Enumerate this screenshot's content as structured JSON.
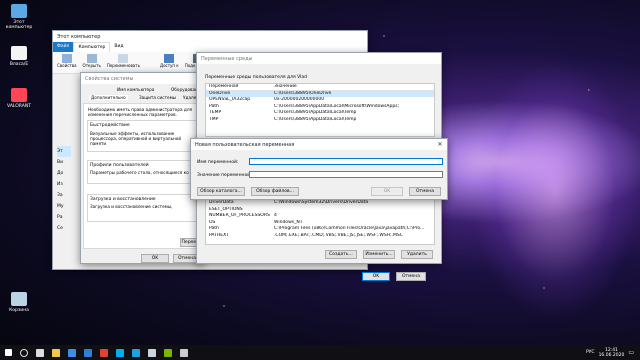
{
  "desktop": {
    "icons": [
      {
        "label": "Этот компьютер",
        "icon": "computer-icon"
      },
      {
        "label": "Власа/Е",
        "icon": "folder-icon"
      },
      {
        "label": "VALORANT",
        "icon": "valorant-icon"
      },
      {
        "label": "Корзина",
        "icon": "recycle-bin-icon"
      }
    ]
  },
  "explorer": {
    "title": "Этот компьютер",
    "tabs": [
      "Файл",
      "Компьютер",
      "Вид"
    ],
    "ribbon": [
      "Свойства",
      "Открыть",
      "Переименовать",
      "Доступ к",
      "Подключить"
    ],
    "sidebar": [
      "Эт",
      "Ви",
      "До",
      "Из",
      "За",
      "Му",
      "Ра",
      "Се"
    ]
  },
  "sysprops": {
    "title": "Свойства системы",
    "tabs": [
      "Имя компьютера",
      "Оборудование",
      "Дополнительно",
      "Защита системы",
      "Удаленный"
    ],
    "admin_note": "Необходимо иметь права администратора для изменения перечисленных параметров.",
    "perf_title": "Быстродействие",
    "perf_text": "Визуальные эффекты, использование процессора, оперативной и виртуальной памяти",
    "profiles_title": "Профили пользователей",
    "profiles_text": "Параметры рабочего стола, относящиеся ко входу",
    "startup_title": "Загрузка и восстановление",
    "startup_text": "Загрузка и восстановление системы, отладочная информация",
    "envvars_button": "Перемен",
    "ok": "OK",
    "cancel": "Отмена"
  },
  "envvars": {
    "title": "Переменные среды",
    "user_section": "Переменные среды пользователя для Vlad",
    "col_name": "Переменная",
    "col_value": "Значение",
    "user_vars": [
      {
        "name": "OneDrive",
        "value": "C:\\Users\\38895\\OneDrive"
      },
      {
        "name": "OPENSSL_IA32cap",
        "value": "0x-200000200000000"
      },
      {
        "name": "Path",
        "value": "C:\\Users\\38895\\AppData\\Local\\Microsoft\\WindowsApps;"
      },
      {
        "name": "TEMP",
        "value": "C:\\Users\\38895\\AppData\\Local\\Temp"
      },
      {
        "name": "TMP",
        "value": "C:\\Users\\38895\\AppData\\Local\\Temp"
      }
    ],
    "system_vars": [
      {
        "name": "DriverData",
        "value": "C:\\Windows\\System32\\Drivers\\DriverData"
      },
      {
        "name": "ESET_OPTIONS",
        "value": ""
      },
      {
        "name": "NUMBER_OF_PROCESSORS",
        "value": "4"
      },
      {
        "name": "OS",
        "value": "Windows_NT"
      },
      {
        "name": "Path",
        "value": "C:\\Program Files (x86)\\Common Files\\Oracle\\Java\\javapath;C:\\Pro..."
      },
      {
        "name": "PATHEXT",
        "value": ".COM;.EXE;.BAT;.CMD;.VBS;.VBE;.JS;.JSE;.WSF;.WSH;.MSC"
      }
    ],
    "create": "Создать...",
    "change": "Изменить...",
    "delete": "Удалить",
    "ok": "OK",
    "cancel": "Отмена"
  },
  "newvar": {
    "title": "Новая пользовательская переменная",
    "name_label": "Имя переменной:",
    "value_label": "Значение переменной:",
    "name_value": "",
    "value_value": "",
    "browse_dir": "Обзор каталога...",
    "browse_file": "Обзор файлов...",
    "ok": "OK",
    "cancel": "Отмена"
  },
  "taskbar": {
    "lang": "РУС",
    "time": "12:41",
    "date": "16.06.2020",
    "icons": [
      {
        "name": "start-icon",
        "color": "#ffffff"
      },
      {
        "name": "search-icon",
        "color": "#dddddd"
      },
      {
        "name": "task-view-icon",
        "color": "#dddddd"
      },
      {
        "name": "file-explorer-icon",
        "color": "#f2c94c"
      },
      {
        "name": "store-icon",
        "color": "#3c8ee8"
      },
      {
        "name": "mail-icon",
        "color": "#2f7fd6"
      },
      {
        "name": "chrome-icon",
        "color": "#e34133"
      },
      {
        "name": "skype-icon",
        "color": "#00aff0"
      },
      {
        "name": "edge-icon",
        "color": "#1fa0e0"
      },
      {
        "name": "steam-icon",
        "color": "#c7d5e0"
      },
      {
        "name": "nvidia-icon",
        "color": "#76b900"
      },
      {
        "name": "settings-icon",
        "color": "#cccccc"
      }
    ]
  }
}
